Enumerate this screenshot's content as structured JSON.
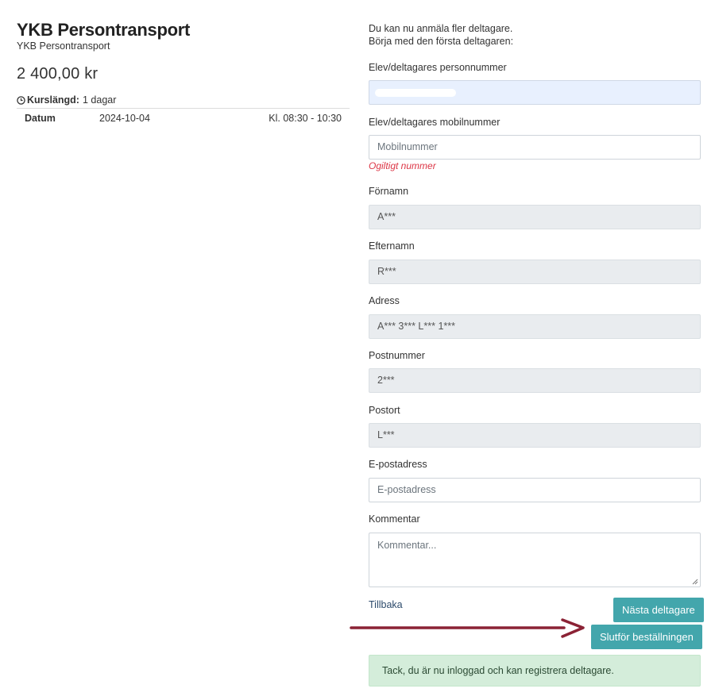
{
  "course": {
    "title": "YKB Persontransport",
    "subtitle": "YKB Persontransport",
    "price": "2 400,00 kr",
    "duration_label": "Kurslängd:",
    "duration_value": "1 dagar",
    "date_label": "Datum",
    "date": "2024-10-04",
    "time": "Kl. 08:30 - 10:30"
  },
  "form": {
    "intro_line1": "Du kan nu anmäla fler deltagare.",
    "intro_line2": "Börja med den första deltagaren:",
    "personnummer": {
      "label": "Elev/deltagares personnummer",
      "value": ""
    },
    "mobil": {
      "label": "Elev/deltagares mobilnummer",
      "placeholder": "Mobilnummer",
      "error": "Ogiltigt nummer"
    },
    "fornamn": {
      "label": "Förnamn",
      "value": "A***"
    },
    "efternamn": {
      "label": "Efternamn",
      "value": "R***"
    },
    "adress": {
      "label": "Adress",
      "value": "A*** 3*** L*** 1***"
    },
    "postnummer": {
      "label": "Postnummer",
      "value": "2***"
    },
    "postort": {
      "label": "Postort",
      "value": "L***"
    },
    "epost": {
      "label": "E-postadress",
      "placeholder": "E-postadress"
    },
    "kommentar": {
      "label": "Kommentar",
      "placeholder": "Kommentar..."
    }
  },
  "actions": {
    "back_label": "Tillbaka",
    "next_label": "Nästa deltagare",
    "finish_label": "Slutför beställningen"
  },
  "alert": {
    "text": "Tack, du är nu inloggad och kan registrera deltagare."
  },
  "colors": {
    "button": "#43a6ac",
    "error": "#dc3545",
    "alert_bg": "#d4edda",
    "arrow": "#8b2235"
  }
}
